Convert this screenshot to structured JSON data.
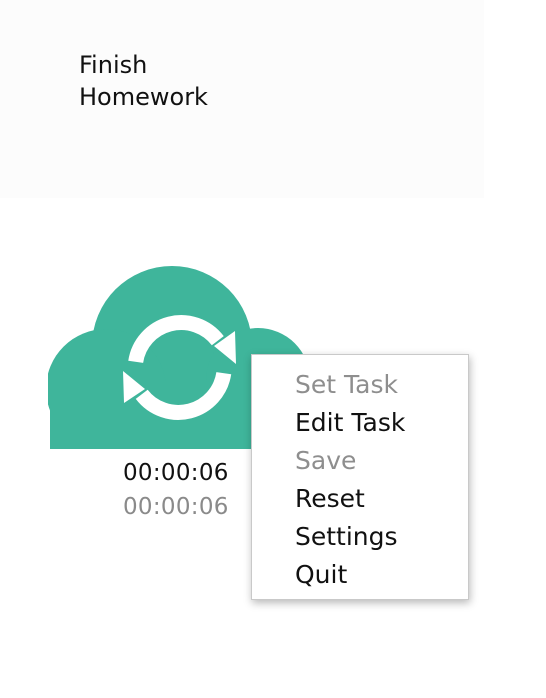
{
  "task": {
    "title": "Finish\nHomework"
  },
  "widget": {
    "icon": "cloud-sync-icon",
    "color": "#3fb59b",
    "elapsed": "00:00:06",
    "total": "00:00:06"
  },
  "context_menu": {
    "items": [
      {
        "label": "Set Task",
        "enabled": false
      },
      {
        "label": "Edit Task",
        "enabled": true
      },
      {
        "label": "Save",
        "enabled": false
      },
      {
        "label": "Reset",
        "enabled": true
      },
      {
        "label": "Settings",
        "enabled": true
      },
      {
        "label": "Quit",
        "enabled": true
      }
    ]
  }
}
